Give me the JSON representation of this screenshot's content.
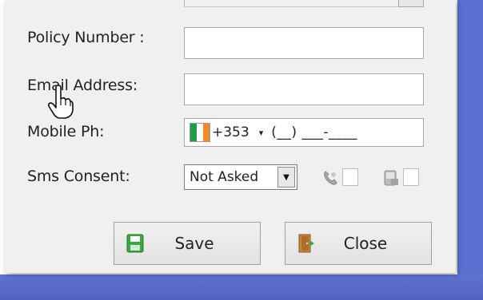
{
  "form": {
    "policy_number_label": "Policy Number :",
    "policy_number_value": "",
    "email_label": "Email Address:",
    "email_value": "",
    "mobile_label": "Mobile Ph:",
    "mobile": {
      "country_flag": "ireland-flag-icon",
      "dial_code": "+353",
      "dropdown_arrow": "▾",
      "mask": "(__) ___-____"
    },
    "sms_label": "Sms Consent:",
    "sms_consent": {
      "selected": "Not Asked",
      "dropdown_arrow": "▼",
      "icon_1": "phone-icon",
      "icon_2": "sms-device-icon"
    }
  },
  "buttons": {
    "save_label": "Save",
    "close_label": "Close"
  },
  "colors": {
    "dialog_background": "#f0f0f0",
    "desktop_blue": "#5a6fd0",
    "flag_green": "#1e9c4a",
    "flag_orange": "#f28a2a"
  }
}
